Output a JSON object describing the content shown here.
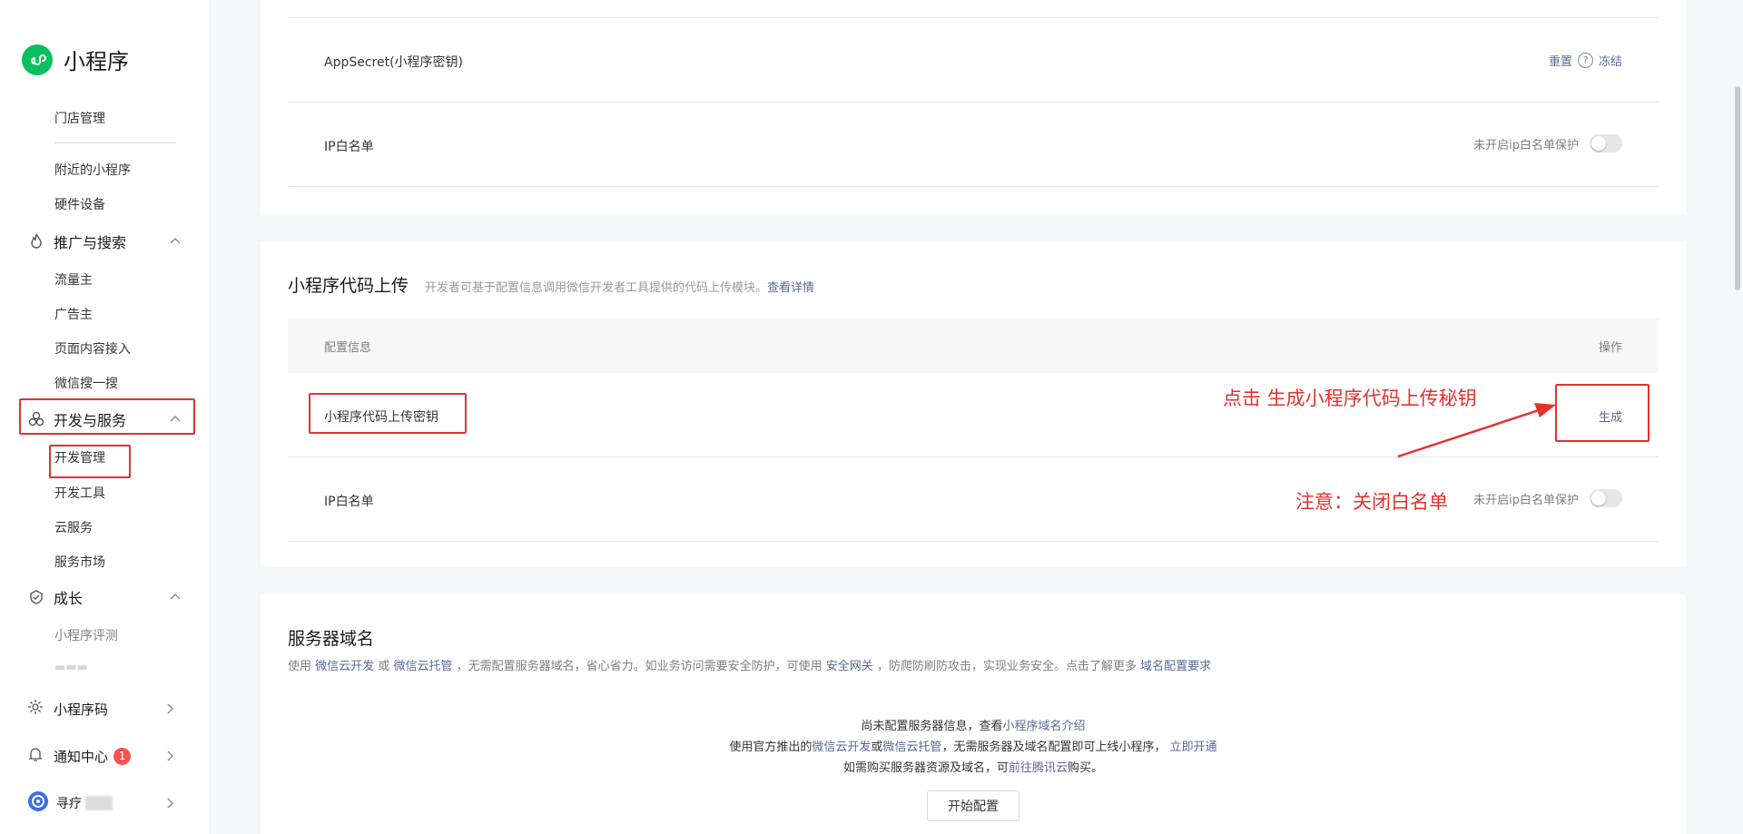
{
  "sidebar": {
    "brand_title": "小程序",
    "items_top": [
      "门店管理",
      "附近的小程序",
      "硬件设备"
    ],
    "group_promo": "推广与搜索",
    "promo_items": [
      "流量主",
      "广告主",
      "页面内容接入",
      "微信搜一搜"
    ],
    "group_dev": "开发与服务",
    "dev_items": [
      "开发管理",
      "开发工具",
      "云服务",
      "服务市场"
    ],
    "group_growth": "成长",
    "growth_items": [
      "小程序评测"
    ],
    "bottom": {
      "qrcode_label": "小程序码",
      "notice_label": "通知中心",
      "notice_count": "1",
      "account_label": "寻疗"
    }
  },
  "appsecret_panel": {
    "appsecret_label": "AppSecret(小程序密钥)",
    "reset_link": "重置",
    "help_mark": "?",
    "freeze_link": "冻结",
    "ip_label": "IP白名单",
    "ip_status": "未开启ip白名单保护"
  },
  "upload_panel": {
    "title": "小程序代码上传",
    "desc": "开发者可基于配置信息调用微信开发者工具提供的代码上传模块。",
    "detail_link": "查看详情",
    "col_config": "配置信息",
    "col_action": "操作",
    "key_label": "小程序代码上传密钥",
    "generate_link": "生成",
    "ip_label": "IP白名单",
    "ip_status": "未开启ip白名单保护"
  },
  "annotations": {
    "click_generate": "点击 生成小程序代码上传秘钥",
    "close_whitelist": "注意：关闭白名单"
  },
  "server_panel": {
    "title": "服务器域名",
    "desc_prefix": "使用",
    "link_cloud_dev": "微信云开发",
    "desc_or": "或",
    "link_cloud_host": "微信云托管",
    "desc_mid": "，无需配置服务器域名，省心省力。如业务访问需要安全防护，可使用",
    "link_gateway": "安全网关",
    "desc_mid2": "，防爬防刷防攻击，实现业务安全。点击了解更多",
    "link_domain_req": "域名配置要求",
    "line1_text": "尚未配置服务器信息，查看",
    "line1_link": "小程序域名介绍",
    "line2_prefix": "使用官方推出的",
    "line2_link1": "微信云开发",
    "line2_or": "或",
    "line2_link2": "微信云托管",
    "line2_mid": "，无需服务器及域名配置即可上线小程序，",
    "line2_link3": "立即开通",
    "line3_prefix": "如需购买服务器资源及域名，可",
    "line3_link": "前往腾讯云",
    "line3_suffix": "购买。",
    "start_button": "开始配置"
  },
  "colors": {
    "brand_green": "#07c160",
    "link_blue": "#576b95",
    "annotation_red": "#e5312c",
    "badge_red": "#fa5151"
  }
}
